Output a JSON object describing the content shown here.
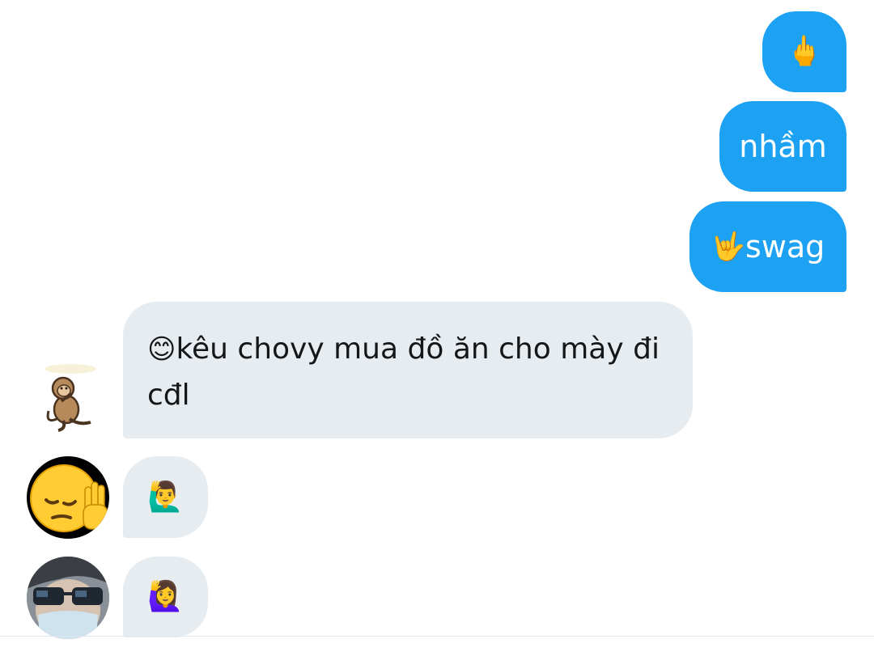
{
  "messages": {
    "sent": [
      {
        "emoji": "🖕",
        "text": ""
      },
      {
        "emoji": "",
        "text": "nhầm"
      },
      {
        "emoji": "🤟",
        "text": "swag"
      }
    ],
    "received": [
      {
        "emoji": "😊",
        "text": "kêu chovy mua đồ ăn cho mày đi cđl"
      },
      {
        "emoji": "🙋‍♂️",
        "text": ""
      },
      {
        "emoji": "🙋‍♀️",
        "text": ""
      }
    ]
  },
  "colors": {
    "sent_bubble": "#1da1f2",
    "received_bubble": "#e6ecf0",
    "text_dark": "#14171a"
  },
  "avatars": [
    {
      "icon": "monkey-sticker-icon"
    },
    {
      "icon": "pensive-hand-emoji-icon"
    },
    {
      "icon": "sunglasses-person-photo-icon"
    }
  ]
}
